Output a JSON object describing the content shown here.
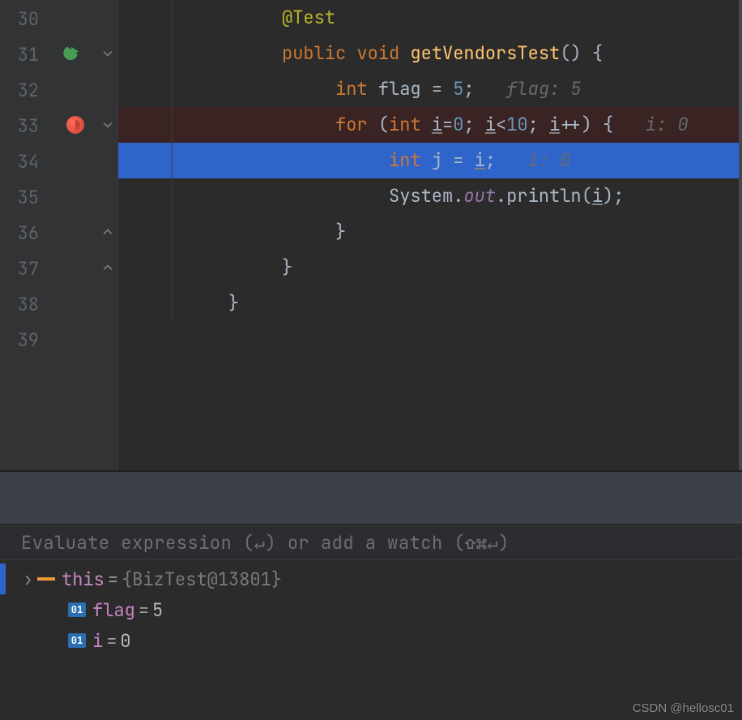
{
  "gutter": {
    "start": 30,
    "end": 39
  },
  "markers": {
    "run_line": 31,
    "breakpoint_line": 33,
    "execution_line": 34,
    "folds": [
      31,
      33,
      36,
      37
    ]
  },
  "code": {
    "30": {
      "indent": 3,
      "tokens": [
        [
          "anno",
          "@Test"
        ]
      ]
    },
    "31": {
      "indent": 3,
      "tokens": [
        [
          "kw",
          "public"
        ],
        [
          "id",
          " "
        ],
        [
          "kw",
          "void"
        ],
        [
          "id",
          " "
        ],
        [
          "method",
          "getVendorsTest"
        ],
        [
          "punc",
          "() {"
        ]
      ]
    },
    "32": {
      "indent": 4,
      "tokens": [
        [
          "kw",
          "int"
        ],
        [
          "id",
          " flag "
        ],
        [
          "punc",
          "= "
        ],
        [
          "num",
          "5"
        ],
        [
          "punc",
          ";"
        ]
      ],
      "inlay": "flag: 5"
    },
    "33": {
      "indent": 4,
      "tokens": [
        [
          "kw",
          "for"
        ],
        [
          "id",
          " "
        ],
        [
          "punc",
          "("
        ],
        [
          "kw",
          "int"
        ],
        [
          "id",
          " "
        ],
        [
          "under",
          "i"
        ],
        [
          "punc",
          "="
        ],
        [
          "num",
          "0"
        ],
        [
          "punc",
          "; "
        ],
        [
          "under",
          "i"
        ],
        [
          "punc",
          "<"
        ],
        [
          "num",
          "10"
        ],
        [
          "punc",
          "; "
        ],
        [
          "under",
          "i"
        ],
        [
          "punc",
          "++) {"
        ]
      ],
      "inlay": "i: 0"
    },
    "34": {
      "indent": 5,
      "tokens": [
        [
          "kw",
          "int"
        ],
        [
          "id",
          " j "
        ],
        [
          "punc",
          "= "
        ],
        [
          "under",
          "i"
        ],
        [
          "punc",
          ";"
        ]
      ],
      "inlay": "i: 0"
    },
    "35": {
      "indent": 5,
      "tokens": [
        [
          "id",
          "System."
        ],
        [
          "field",
          "out"
        ],
        [
          "id",
          ".println("
        ],
        [
          "under",
          "i"
        ],
        [
          "punc",
          ");"
        ]
      ]
    },
    "36": {
      "indent": 4,
      "tokens": [
        [
          "punc",
          "}"
        ]
      ]
    },
    "37": {
      "indent": 3,
      "tokens": [
        [
          "punc",
          "}"
        ]
      ]
    },
    "38": {
      "indent": 2,
      "tokens": [
        [
          "punc",
          "}"
        ]
      ]
    },
    "39": {
      "indent": 0,
      "tokens": []
    }
  },
  "debug": {
    "eval_placeholder": "Evaluate expression (↵) or add a watch (⇧⌘↵)",
    "vars": [
      {
        "icon": "obj",
        "name": "this",
        "value": "{BizTest@13801}",
        "expandable": true,
        "valClass": "var-val-obj"
      },
      {
        "icon": "prim",
        "iconText": "01",
        "name": "flag",
        "value": "5",
        "expandable": false,
        "valClass": "var-val"
      },
      {
        "icon": "prim",
        "iconText": "01",
        "name": "i",
        "value": "0",
        "expandable": false,
        "valClass": "var-val"
      }
    ]
  },
  "watermark": "CSDN @hellosc01"
}
